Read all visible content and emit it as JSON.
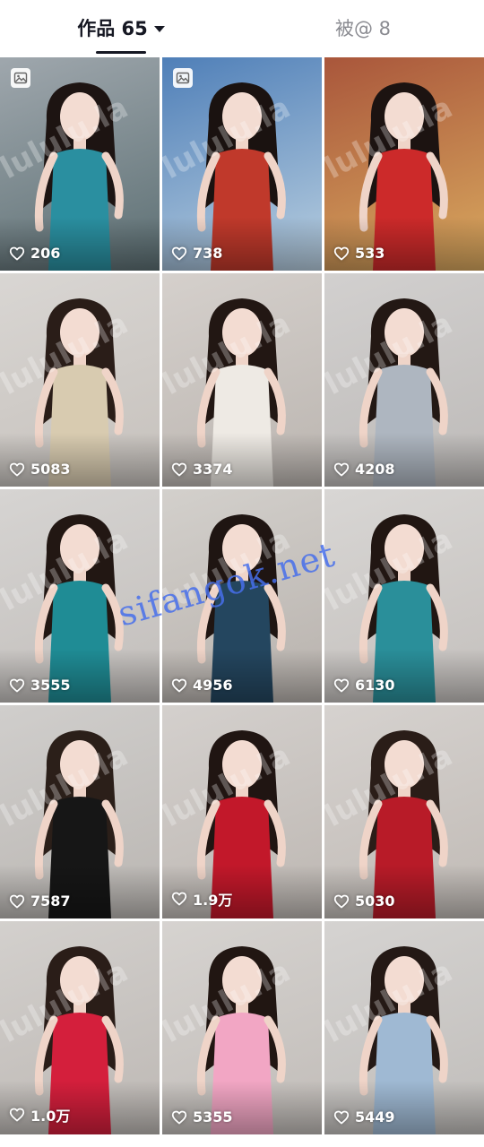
{
  "tabs": [
    {
      "label": "作品 65",
      "active": true
    },
    {
      "label": "被@ 8",
      "active": false
    }
  ],
  "videos": [
    {
      "likes": "206",
      "bg": [
        "#9fa7ad",
        "#5c6f73"
      ],
      "outfit": "#2a8fa0",
      "hair": "#1d1412",
      "has_image_badge": true
    },
    {
      "likes": "738",
      "bg": [
        "#4f7fb8",
        "#b9cfe0"
      ],
      "outfit": "#c0392b",
      "hair": "#1a1210",
      "has_image_badge": true
    },
    {
      "likes": "533",
      "bg": [
        "#a9563b",
        "#d9a95f"
      ],
      "outfit": "#cc2a2a",
      "hair": "#1c1311",
      "has_image_badge": false
    },
    {
      "likes": "5083",
      "bg": [
        "#d9d6d3",
        "#c6c1bc"
      ],
      "outfit": "#d8cbb0",
      "hair": "#2a1d18",
      "has_image_badge": false
    },
    {
      "likes": "3374",
      "bg": [
        "#d5d0cc",
        "#bbb5b0"
      ],
      "outfit": "#eeeae4",
      "hair": "#221713",
      "has_image_badge": false
    },
    {
      "likes": "4208",
      "bg": [
        "#d2d0cf",
        "#bdbab8"
      ],
      "outfit": "#aeb6c0",
      "hair": "#231814",
      "has_image_badge": false
    },
    {
      "likes": "3555",
      "bg": [
        "#d6d4d2",
        "#c2bebb"
      ],
      "outfit": "#1f8c95",
      "hair": "#221713",
      "has_image_badge": false
    },
    {
      "likes": "4956",
      "bg": [
        "#d3d0cc",
        "#b8b2ad"
      ],
      "outfit": "#24465f",
      "hair": "#1f1512",
      "has_image_badge": false
    },
    {
      "likes": "6130",
      "bg": [
        "#d8d6d4",
        "#c4c0bd"
      ],
      "outfit": "#2a8f9a",
      "hair": "#211612",
      "has_image_badge": false
    },
    {
      "likes": "7587",
      "bg": [
        "#d0cecc",
        "#bab6b2"
      ],
      "outfit": "#161616",
      "hair": "#2b1f19",
      "has_image_badge": false
    },
    {
      "likes": "1.9万",
      "bg": [
        "#d4d0cd",
        "#bdb7b2"
      ],
      "outfit": "#c2182a",
      "hair": "#201512",
      "has_image_badge": false
    },
    {
      "likes": "5030",
      "bg": [
        "#d6d2cf",
        "#c0bab5"
      ],
      "outfit": "#b81b28",
      "hair": "#2a1d18",
      "has_image_badge": false
    },
    {
      "likes": "1.0万",
      "bg": [
        "#d3d0cd",
        "#bdb8b4"
      ],
      "outfit": "#d41f3c",
      "hair": "#2a1d18",
      "has_image_badge": false
    },
    {
      "likes": "5355",
      "bg": [
        "#d6d3d0",
        "#c1bcb8"
      ],
      "outfit": "#f2a6c4",
      "hair": "#211612",
      "has_image_badge": false
    },
    {
      "likes": "5449",
      "bg": [
        "#d5d3d1",
        "#c0bdba"
      ],
      "outfit": "#9fb9d3",
      "hair": "#241915",
      "has_image_badge": false
    }
  ],
  "watermark": {
    "site": "sifangok.net",
    "tile": "lululu.la"
  },
  "colors": {
    "text_primary": "#161823",
    "text_secondary": "#8a8b91",
    "watermark_blue": "#466eeb"
  }
}
